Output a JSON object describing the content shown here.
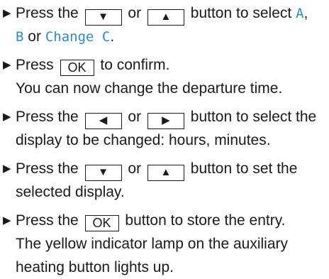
{
  "keys": {
    "down": "▼",
    "up": "▲",
    "left": "◀",
    "right": "▶",
    "ok": "OK"
  },
  "display_values": {
    "a": "A",
    "b": "B",
    "change_c": "Change C"
  },
  "steps": [
    {
      "lines": [
        {
          "t1": "Press the",
          "t2": "or",
          "t3": "button to select"
        },
        {
          "t1": "or"
        }
      ]
    },
    {
      "lines": [
        {
          "t1": "Press",
          "t2": "to confirm."
        },
        {
          "t1": "You can now change the departure time."
        }
      ]
    },
    {
      "lines": [
        {
          "t1": "Press the",
          "t2": "or",
          "t3": "button to select the"
        },
        {
          "t1": "display to be changed: hours, minutes."
        }
      ]
    },
    {
      "lines": [
        {
          "t1": "Press the",
          "t2": "or",
          "t3": "button to set the"
        },
        {
          "t1": "selected display."
        }
      ]
    },
    {
      "lines": [
        {
          "t1": "Press the",
          "t2": "button to store the entry."
        },
        {
          "t1": "The yellow indicator lamp on the auxiliary"
        },
        {
          "t1": "heating button lights up."
        }
      ]
    }
  ],
  "colors": {
    "display_text": "#2a8fc4",
    "body_text": "#1a1a1a"
  }
}
